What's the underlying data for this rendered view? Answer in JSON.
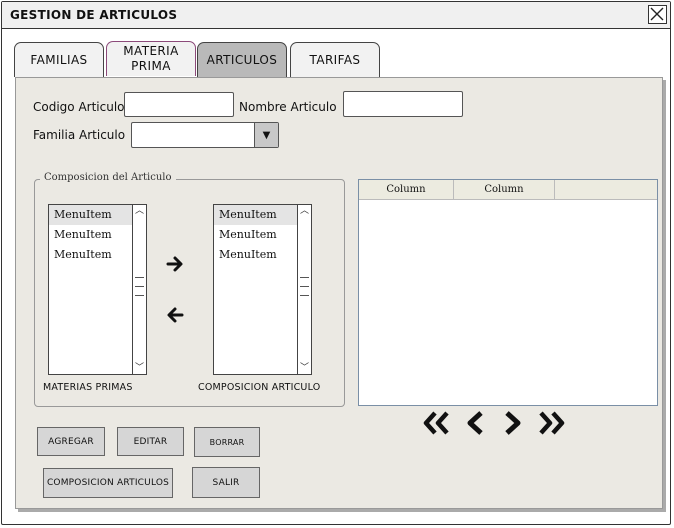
{
  "window": {
    "title": "GESTION DE ARTICULOS",
    "close_icon": "close-icon"
  },
  "tabs": [
    {
      "label": "FAMILIAS",
      "active": false
    },
    {
      "label": "MATERIA PRIMA",
      "active": false
    },
    {
      "label": "ARTICULOS",
      "active": true
    },
    {
      "label": "TARIFAS",
      "active": false
    }
  ],
  "form": {
    "codigo_label": "Codigo Articulo",
    "codigo_value": "",
    "nombre_label": "Nombre Articulo",
    "nombre_value": "",
    "familia_label": "Familia Articulo",
    "familia_value": "",
    "familia_arrow": "▼"
  },
  "composition": {
    "legend": "Composicion del Articulo",
    "left_list": {
      "items": [
        "MenuItem",
        "MenuItem",
        "MenuItem"
      ],
      "caption": "MATERIAS PRIMAS"
    },
    "right_list": {
      "items": [
        "MenuItem",
        "MenuItem",
        "MenuItem"
      ],
      "caption": "COMPOSICION ARTICULO"
    },
    "move_right_icon": "arrow-right-icon",
    "move_left_icon": "arrow-left-icon"
  },
  "grid": {
    "columns": [
      "Column",
      "Column",
      ""
    ]
  },
  "buttons": {
    "agregar": "AGREGAR",
    "editar": "EDITAR",
    "borrar": "BORRAR",
    "composicion": "COMPOSICION ARTICULOS",
    "salir": "SALIR"
  },
  "pagination": [
    "first-page-icon",
    "prev-page-icon",
    "next-page-icon",
    "last-page-icon"
  ],
  "colors": {
    "panel": "#ebe9e3",
    "active_tab": "#b9b9b9",
    "button": "#d6d6d6"
  }
}
